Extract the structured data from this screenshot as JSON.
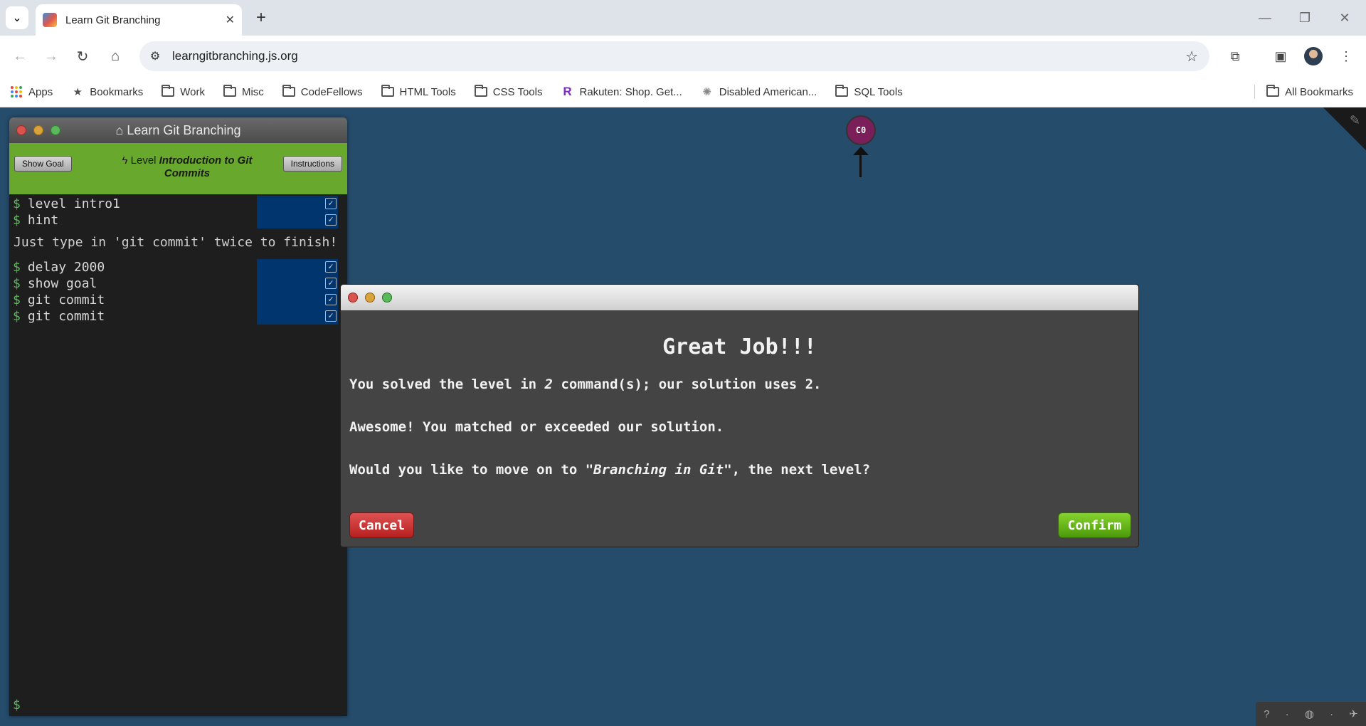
{
  "browser": {
    "tab_title": "Learn Git Branching",
    "url": "learngitbranching.js.org",
    "bookmarks": [
      {
        "label": "Apps",
        "icon": "apps-grid-icon"
      },
      {
        "label": "Bookmarks",
        "icon": "star-icon"
      },
      {
        "label": "Work",
        "icon": "folder-icon"
      },
      {
        "label": "Misc",
        "icon": "folder-icon"
      },
      {
        "label": "CodeFellows",
        "icon": "folder-icon"
      },
      {
        "label": "HTML Tools",
        "icon": "folder-icon"
      },
      {
        "label": "CSS Tools",
        "icon": "folder-icon"
      },
      {
        "label": "Rakuten: Shop. Get...",
        "icon": "rakuten-icon"
      },
      {
        "label": "Disabled American...",
        "icon": "gear-badge-icon"
      },
      {
        "label": "SQL Tools",
        "icon": "folder-icon"
      }
    ],
    "all_bookmarks": "All Bookmarks"
  },
  "terminal": {
    "title": "Learn Git Branching",
    "show_goal": "Show Goal",
    "level_prefix": "Level",
    "level_name": "Introduction to Git Commits",
    "instructions": "Instructions",
    "commands_a": [
      "level intro1",
      "hint"
    ],
    "hint_text": "Just type in 'git commit' twice to finish!",
    "commands_b": [
      "delay 2000",
      "show goal",
      "git commit",
      "git commit"
    ],
    "prompt": "$"
  },
  "graph": {
    "commit_label": "C0"
  },
  "modal": {
    "title": "Great Job!!!",
    "line1_pre": "You solved the level in ",
    "line1_num": "2",
    "line1_post": " command(s); our solution uses 2.",
    "line2": "Awesome! You matched or exceeded our solution.",
    "line3_pre": "Would you like to move on to ",
    "line3_level": "\"Branching in Git\"",
    "line3_post": ", the next level?",
    "cancel": "Cancel",
    "confirm": "Confirm"
  },
  "colors": {
    "page_bg": "#264c6b",
    "level_bar": "#68a82c",
    "commit": "#7a1f59",
    "cancel": "#c9302c",
    "confirm": "#5cb811"
  }
}
